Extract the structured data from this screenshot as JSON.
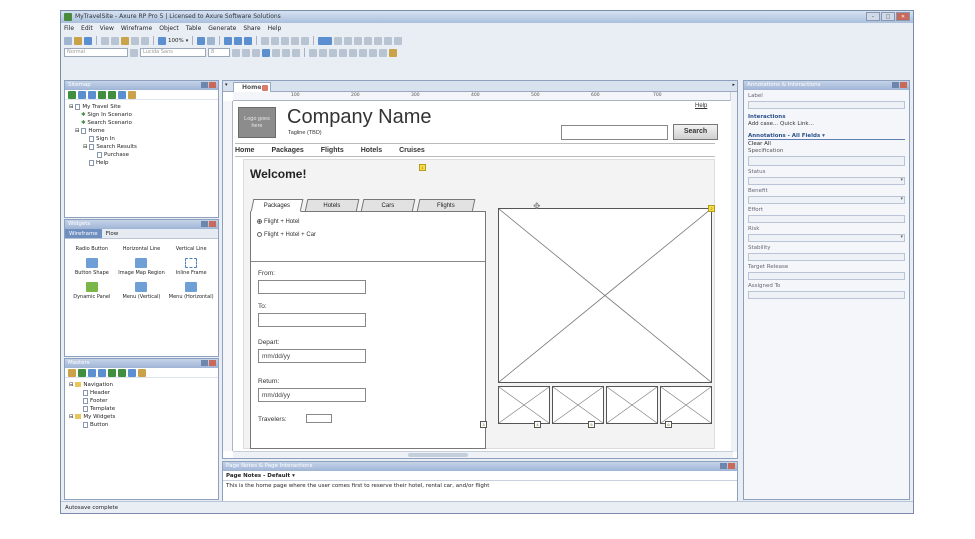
{
  "window": {
    "title": "MyTravelSite - Axure RP Pro 5 | Licensed to Axure Software Solutions"
  },
  "menu": [
    "File",
    "Edit",
    "View",
    "Wireframe",
    "Object",
    "Table",
    "Generate",
    "Share",
    "Help"
  ],
  "toolbar": {
    "zoom": "100%",
    "style_select": "Normal",
    "font_select": "Lucida Sans",
    "size_select": "8"
  },
  "sitemap": {
    "title": "Sitemap",
    "items": [
      {
        "label": "My Travel Site",
        "depth": 0
      },
      {
        "label": "Sign In Scenario",
        "depth": 1
      },
      {
        "label": "Search Scenario",
        "depth": 1
      },
      {
        "label": "Home",
        "depth": 1
      },
      {
        "label": "Sign In",
        "depth": 2
      },
      {
        "label": "Search Results",
        "depth": 2
      },
      {
        "label": "Purchase",
        "depth": 3
      },
      {
        "label": "Help",
        "depth": 2
      }
    ]
  },
  "widgets": {
    "title": "Widgets",
    "tabs": [
      "Wireframe",
      "Flow"
    ],
    "items": [
      "Radio Button",
      "Horizontal Line",
      "Vertical Line",
      "Button Shape",
      "Image Map Region",
      "Inline Frame",
      "Dynamic Panel",
      "Menu (Vertical)",
      "Menu (Horizontal)"
    ]
  },
  "masters": {
    "title": "Masters",
    "items": [
      {
        "label": "Navigation",
        "depth": 0,
        "folder": true
      },
      {
        "label": "Header",
        "depth": 1
      },
      {
        "label": "Footer",
        "depth": 1
      },
      {
        "label": "Template",
        "depth": 1
      },
      {
        "label": "My Widgets",
        "depth": 0,
        "folder": true
      },
      {
        "label": "Button",
        "depth": 1
      }
    ]
  },
  "canvas": {
    "tab": "Home",
    "ruler": [
      "100",
      "200",
      "300",
      "400",
      "500",
      "600",
      "700"
    ],
    "page": {
      "logo": "Logo goes here",
      "company": "Company Name",
      "tagline": "Tagline (TBD)",
      "help": "Help",
      "search_button": "Search",
      "nav": [
        "Home",
        "Packages",
        "Flights",
        "Hotels",
        "Cruises"
      ],
      "welcome": "Welcome!",
      "tabs": [
        "Packages",
        "Hotels",
        "Cars",
        "Flights"
      ],
      "radios": [
        "Flight + Hotel",
        "Flight + Hotel + Car"
      ],
      "from_label": "From:",
      "to_label": "To:",
      "depart_label": "Depart:",
      "depart_value": "mm/dd/yy",
      "return_label": "Return:",
      "return_value": "mm/dd/yy",
      "travelers_label": "Travelers:"
    }
  },
  "page_notes": {
    "title": "Page Notes & Page Interactions",
    "selector": "Page Notes - Default",
    "text": "This is the home page where the user comes first to reserve their hotel, rental car, and/or flight"
  },
  "annotations": {
    "title": "Annotations & Interactions",
    "label": "Label",
    "interactions_header": "Interactions",
    "interactions_links": "Add case... Quick Link...",
    "annotations_header": "Annotations - All Fields",
    "clear_all": "Clear All",
    "specification": "Specification",
    "fields": [
      "Status",
      "Benefit",
      "Effort",
      "Risk",
      "Stability",
      "Target Release",
      "Assigned To"
    ]
  },
  "status_bar": "Autosave complete"
}
